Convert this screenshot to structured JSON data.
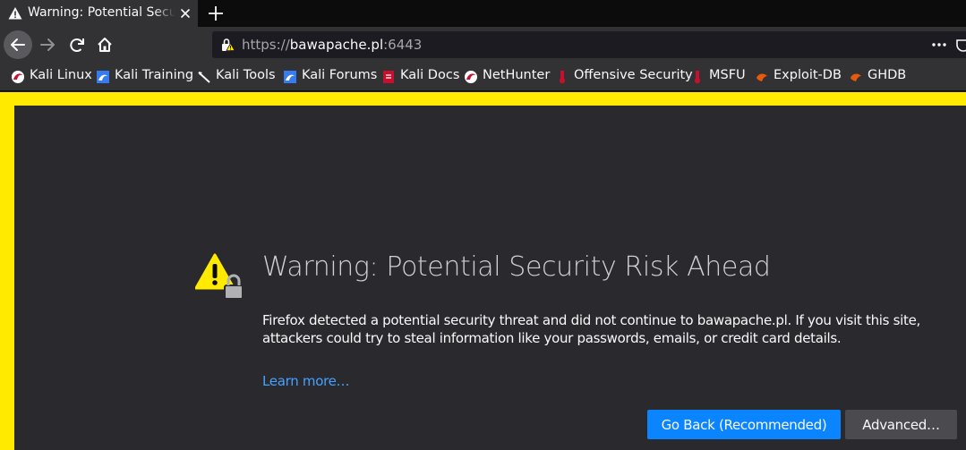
{
  "tab": {
    "title": "Warning: Potential Security Risk Ahead"
  },
  "urlbar": {
    "protocol": "https://",
    "host": "bawapache.pl",
    "port": ":6443"
  },
  "bookmarks": [
    {
      "label": "Kali Linux",
      "icon": "kali-dragon-icon"
    },
    {
      "label": "Kali Training",
      "icon": "kali-training-icon"
    },
    {
      "label": "Kali Tools",
      "icon": "kali-tools-icon"
    },
    {
      "label": "Kali Forums",
      "icon": "kali-forums-icon"
    },
    {
      "label": "Kali Docs",
      "icon": "kali-docs-icon"
    },
    {
      "label": "NetHunter",
      "icon": "nethunter-icon"
    },
    {
      "label": "Offensive Security",
      "icon": "offsec-icon"
    },
    {
      "label": "MSFU",
      "icon": "msfu-icon"
    },
    {
      "label": "Exploit-DB",
      "icon": "exploit-db-icon"
    },
    {
      "label": "GHDB",
      "icon": "ghdb-icon"
    }
  ],
  "page": {
    "title": "Warning: Potential Security Risk Ahead",
    "body": "Firefox detected a potential security threat and did not continue to bawapache.pl. If you visit this site, attackers could try to steal information like your passwords, emails, or credit card details.",
    "learn_more": "Learn more…",
    "go_back": "Go Back (Recommended)",
    "advanced": "Advanced…"
  },
  "colors": {
    "accent_yellow": "#ffea00",
    "primary_button": "#0a84ff",
    "link": "#45a1ff"
  }
}
